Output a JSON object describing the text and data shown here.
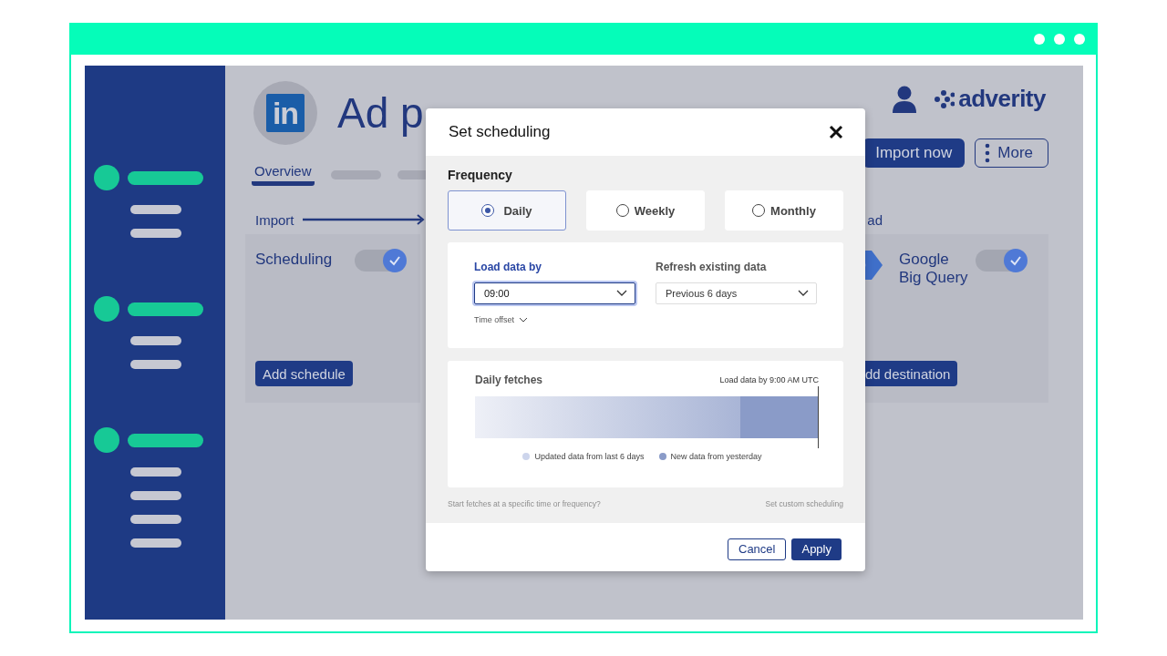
{
  "sidebar": {
    "groups": [
      {
        "items": [
          {
            "kind": "line"
          },
          {
            "kind": "line"
          }
        ]
      },
      {
        "items": [
          {
            "kind": "line"
          },
          {
            "kind": "line"
          }
        ]
      },
      {
        "items": [
          {
            "kind": "line"
          },
          {
            "kind": "line"
          },
          {
            "kind": "line"
          },
          {
            "kind": "line"
          }
        ]
      }
    ]
  },
  "header": {
    "source_logo": "in",
    "title": "Ad p",
    "brand": "adverity",
    "buttons": [
      {
        "label": "Import now",
        "kind": "primary"
      },
      {
        "label": "More",
        "kind": "outline"
      }
    ]
  },
  "tabs": [
    {
      "kind": "text",
      "label": "Overview",
      "selected": true
    },
    {
      "kind": "placeholder",
      "selected": false
    },
    {
      "kind": "placeholder",
      "selected": false
    }
  ],
  "flow": {
    "start": "Import",
    "end": "ad"
  },
  "cards": [
    {
      "kind": "schedule",
      "title": "Scheduling",
      "on": true,
      "button": "Add schedule"
    },
    {
      "kind": "destination",
      "title": "Google Big Query",
      "on": true,
      "button": "dd destination"
    }
  ],
  "dialog": {
    "title": "Set scheduling",
    "frequency_label": "Frequency",
    "options": [
      {
        "label": "Daily",
        "selected": true
      },
      {
        "label": "Weekly",
        "selected": false
      },
      {
        "label": "Monthly",
        "selected": false
      }
    ],
    "fields": [
      {
        "label": "Load data by",
        "value": "09:00",
        "focused": true
      },
      {
        "label": "Refresh existing data",
        "value": "Previous 6 days",
        "focused": false
      }
    ],
    "time_offset": "Time offset",
    "fetches": {
      "title": "Daily fetches",
      "note": "Load data by 9:00 AM UTC",
      "legend": [
        {
          "label": "Updated data from last 6 days",
          "color": "#cdd5ec"
        },
        {
          "label": "New data from yesterday",
          "color": "#8a9bc8"
        }
      ]
    },
    "hint": "Start fetches at a specific time or frequency?",
    "link": "Set custom scheduling",
    "buttons": [
      {
        "label": "Cancel",
        "kind": "outline"
      },
      {
        "label": "Apply",
        "kind": "primary"
      }
    ]
  }
}
